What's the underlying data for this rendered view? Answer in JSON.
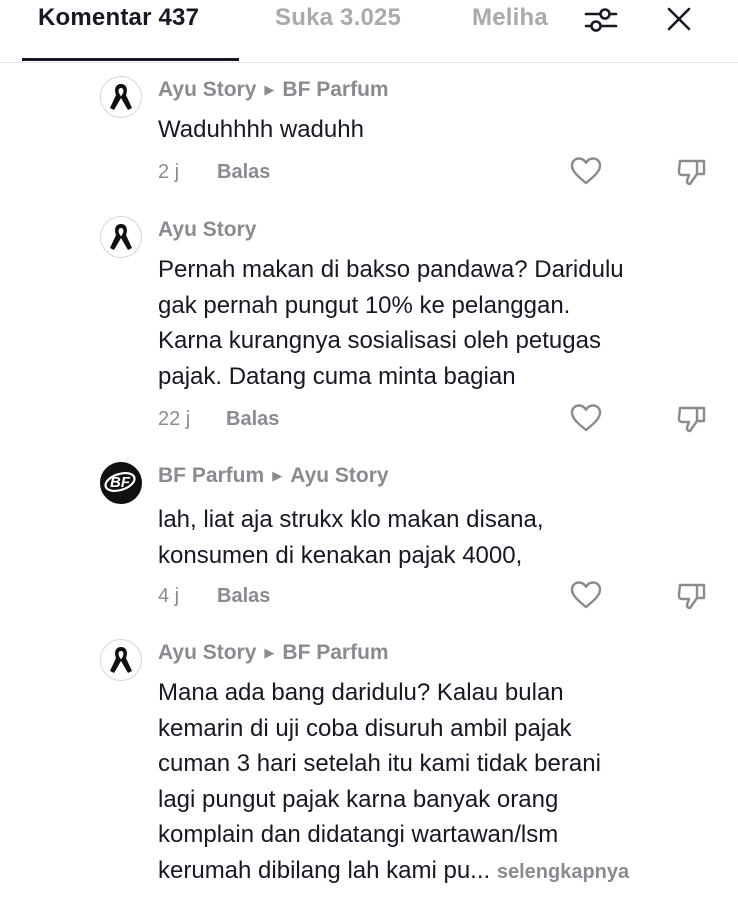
{
  "tabs": {
    "comments": "Komentar 437",
    "likes": "Suka 3.025",
    "views": "Meliha"
  },
  "icons": {
    "filter": "filter-sliders-icon",
    "close": "close-icon",
    "like": "heart-outline-icon",
    "dislike": "thumbs-down-icon",
    "reply_arrow": "triangle-right-icon"
  },
  "reply_arrow_glyph": "▶",
  "comments": [
    {
      "author": "Ayu Story",
      "reply_to": "BF Parfum",
      "text": [
        "Waduhhhh waduhh"
      ],
      "time": "2 j",
      "reply_label": "Balas"
    },
    {
      "author": "Ayu Story",
      "reply_to": "",
      "text": [
        "Pernah makan di bakso pandawa? Daridulu",
        "gak pernah pungut 10% ke pelanggan.",
        "Karna kurangnya sosialisasi oleh petugas",
        "pajak. Datang cuma minta bagian"
      ],
      "time": "22 j",
      "reply_label": "Balas"
    },
    {
      "author": "BF Parfum",
      "reply_to": "Ayu Story",
      "text": [
        "lah, liat aja strukx klo makan disana,",
        "konsumen di kenakan pajak 4000,"
      ],
      "time": "4 j",
      "reply_label": "Balas"
    },
    {
      "author": "Ayu Story",
      "reply_to": "BF Parfum",
      "text": [
        "Mana ada bang daridulu? Kalau bulan",
        "kemarin di uji coba disuruh ambil pajak",
        "cuman 3 hari setelah itu kami tidak berani",
        "lagi pungut pajak karna banyak orang",
        "komplain dan didatangi wartawan/lsm",
        "kerumah dibilang lah kami pu..."
      ],
      "see_more": "selengkapnya"
    }
  ]
}
